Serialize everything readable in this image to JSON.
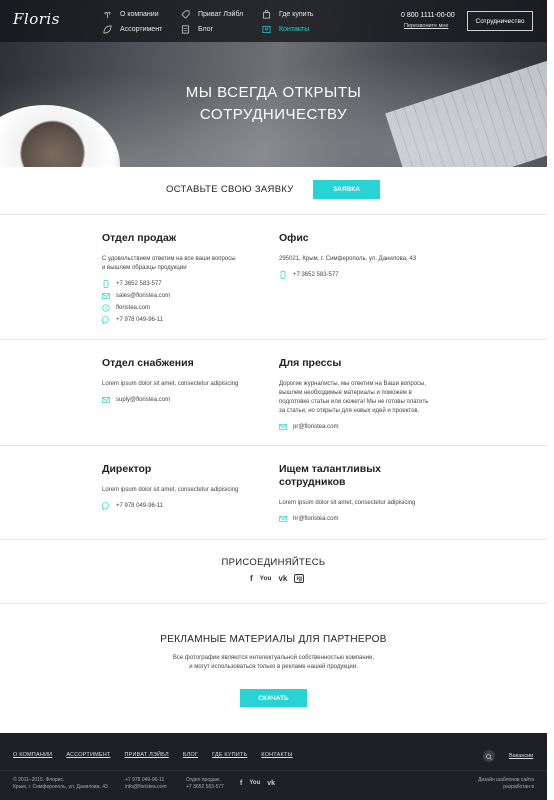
{
  "header": {
    "logo": "Floris",
    "nav": [
      {
        "label": "О компании",
        "icon": "flower-icon"
      },
      {
        "label": "Ассортимент",
        "icon": "leaf-icon"
      },
      {
        "label": "Приват Лэйбл",
        "icon": "tag-icon"
      },
      {
        "label": "Блог",
        "icon": "document-icon"
      },
      {
        "label": "Где купить",
        "icon": "shopping-bag-icon"
      },
      {
        "label": "Контакты",
        "icon": "contacts-icon"
      }
    ],
    "phone": "0 800 1111-00-00",
    "callback": "Перезвоните мне",
    "coop_button": "Сотрудничество"
  },
  "hero": {
    "title_line1": "МЫ ВСЕГДА ОТКРЫТЫ",
    "title_line2": "СОТРУДНИЧЕСТВУ"
  },
  "request": {
    "title": "ОСТАВЬТЕ СВОЮ ЗАЯВКУ",
    "button": "ЗАЯВКА"
  },
  "sales": {
    "title": "Отдел продаж",
    "desc_line1": "С удовольствием ответим на все ваши вопросы",
    "desc_line2": "и вышлем образцы продукции",
    "phone": "+7 3652 583-577",
    "email": "sales@floristea.com",
    "site": "floristea.com",
    "viber": "+7 978 049-96-11"
  },
  "office": {
    "title": "Офис",
    "address": "295021, Крым, г. Симферополь, ул. Данилова, 43",
    "phone": "+7 3652 583-577"
  },
  "supply": {
    "title": "Отдел снабжения",
    "desc": "Lorem ipsum dolor sit amet, consectetur adipisicing",
    "email": "suply@floristea.com"
  },
  "press": {
    "title": "Для прессы",
    "desc_line1": "Дорогие журналисты, мы ответим на Ваши вопросы,",
    "desc_line2": "вышлем необходимые материалы и поможем в",
    "desc_line3": "подготовке статьи или сюжета! Мы не готовы платить",
    "desc_line4": "за статьи, но открыты для новых идей и проектов.",
    "email": "pr@floristea.com"
  },
  "director": {
    "title": "Директор",
    "desc": "Lorem ipsum dolor sit amet, consectetur adipisicing",
    "phone": "+7 978 049-96-11"
  },
  "talent": {
    "title_line1": "Ищем талантливых",
    "title_line2": "сотрудников",
    "desc": "Lorem ipsum dolor sit amet, consectetur adipisicing",
    "email": "hr@floristea.com"
  },
  "join": {
    "title": "ПРИСОЕДИНЯЙТЕСЬ",
    "networks": [
      "f",
      "You",
      "vk",
      "ig"
    ]
  },
  "partners": {
    "title": "РЕКЛАМНЫЕ МАТЕРИАЛЫ ДЛЯ ПАРТНЕРОВ",
    "text_line1": "Все фотографии являются интелектуальной собственностью компании,",
    "text_line2": "и могут использоваться только в рекламе нашей продукции.",
    "button": "СКАЧАТЬ"
  },
  "footer": {
    "nav": [
      "О КОМПАНИИ",
      "АССОРТИМЕНТ",
      "ПРИВАТ ЛЭЙБЛ",
      "БЛОГ",
      "ГДЕ КУПИТЬ",
      "КОНТАКТЫ"
    ],
    "vacancy": "Вакансии",
    "copyright_line1": "© 2011–2015. Флорис.",
    "copyright_line2": "Крым, г. Симферополь, ул. Данилова, 43",
    "contact_phone": "+7 978 049-96-11",
    "contact_email": "info@floristea.com",
    "sales_label": "Отдел продаж:",
    "sales_phone": "+7 3652 583-577",
    "networks": [
      "f",
      "You",
      "vk"
    ],
    "credit_line1": "Дизайн шаблонов сайта",
    "credit_line2": "разработан в"
  },
  "colors": {
    "accent": "#27d3d3",
    "footer_bg": "#1d2125"
  }
}
